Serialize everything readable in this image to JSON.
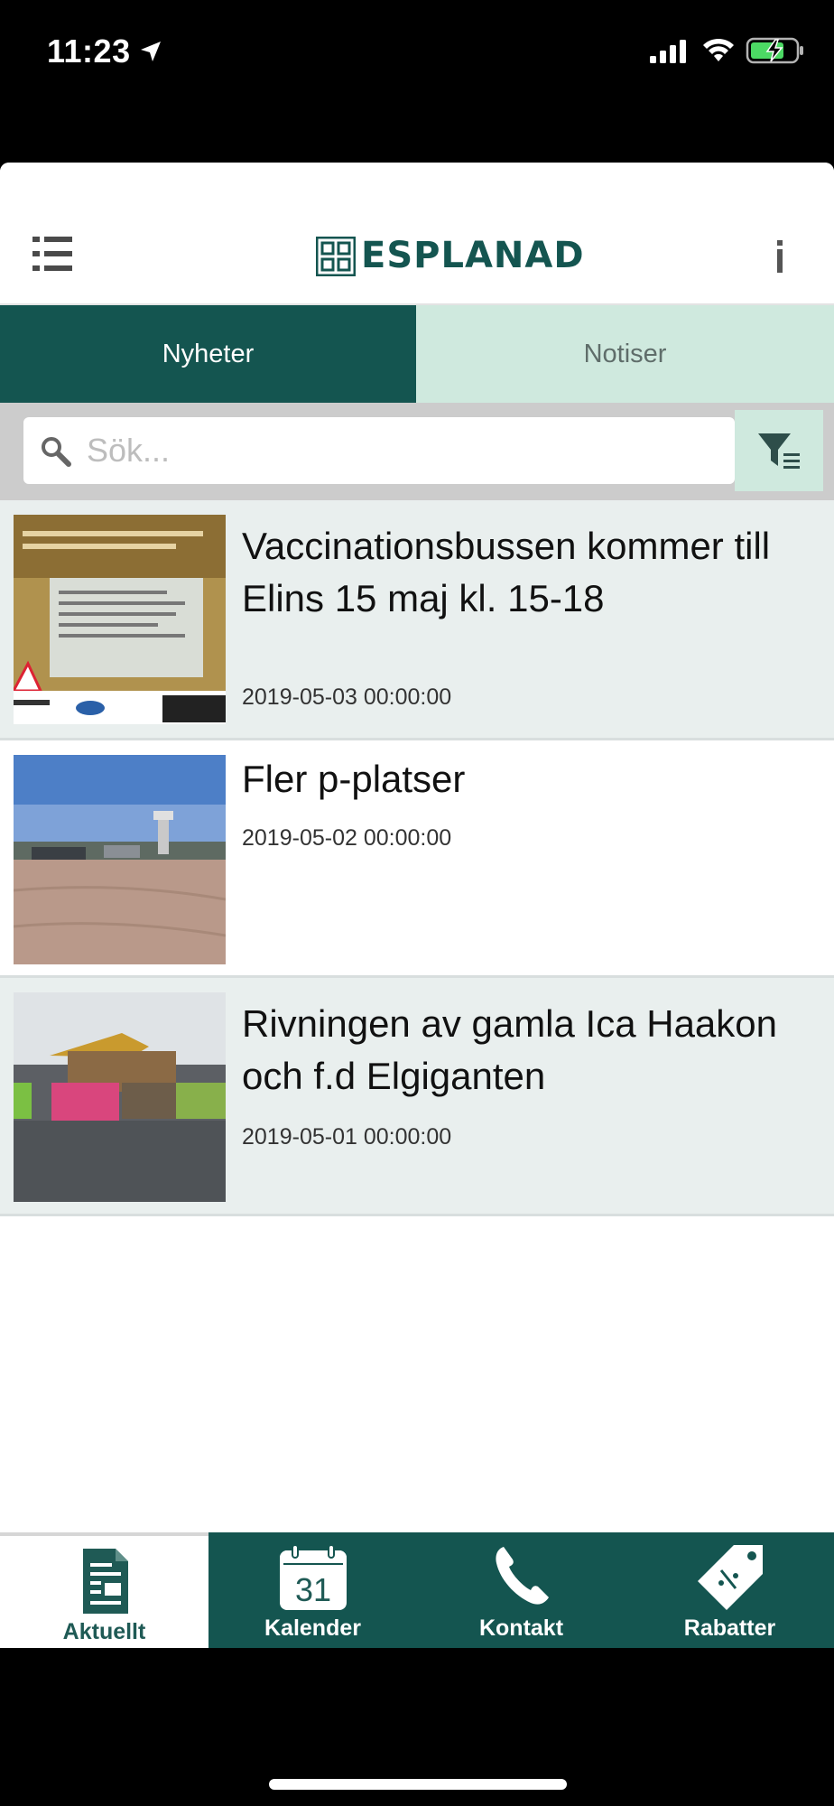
{
  "status_bar": {
    "time": "11:23"
  },
  "header": {
    "logo_text": "ESPLANAD"
  },
  "tabs": [
    {
      "label": "Nyheter",
      "active": true
    },
    {
      "label": "Notiser",
      "active": false
    }
  ],
  "search": {
    "placeholder": "Sök..."
  },
  "news": [
    {
      "title": "Vaccinationsbussen kommer till Elins 15 maj kl. 15-18",
      "date": "2019-05-03 00:00:00"
    },
    {
      "title": "Fler p-platser",
      "date": "2019-05-02 00:00:00"
    },
    {
      "title": "Rivningen av gamla Ica Haakon och f.d Elgiganten",
      "date": "2019-05-01 00:00:00"
    }
  ],
  "bottom_nav": [
    {
      "label": "Aktuellt",
      "icon": "document-icon",
      "active": true
    },
    {
      "label": "Kalender",
      "icon": "calendar-icon",
      "active": false,
      "calendar_day": "31"
    },
    {
      "label": "Kontakt",
      "icon": "phone-icon",
      "active": false
    },
    {
      "label": "Rabatter",
      "icon": "tag-icon",
      "active": false
    }
  ],
  "colors": {
    "brand": "#145550",
    "tab_inactive": "#cfe9de",
    "row_shaded": "#e9efee"
  }
}
